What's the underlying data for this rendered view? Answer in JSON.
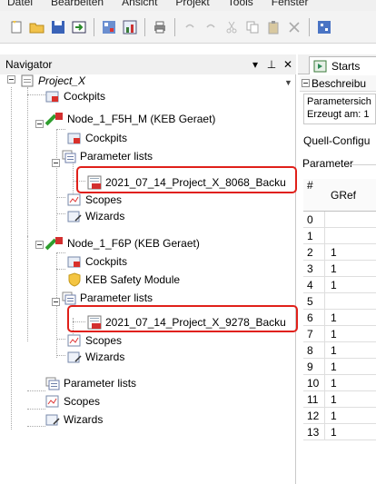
{
  "menubar": [
    "Datei",
    "Bearbeiten",
    "Ansicht",
    "Projekt",
    "Tools",
    "Fenster"
  ],
  "navigator": {
    "title": "Navigator",
    "buttons": {
      "dropdown": "▾",
      "pin": "⊥",
      "close": "✕"
    }
  },
  "tree": {
    "project": "Project_X",
    "project_cockpits": "Cockpits",
    "node1": "Node_1_F5H_M (KEB Geraet)",
    "node1_cockpits": "Cockpits",
    "node1_param_lists": "Parameter lists",
    "node1_backup": "2021_07_14_Project_X_8068_Backu",
    "node1_scopes": "Scopes",
    "node1_wizards": "Wizards",
    "node2": "Node_1_F6P (KEB Geraet)",
    "node2_cockpits": "Cockpits",
    "node2_safety": "KEB Safety Module",
    "node2_param_lists": "Parameter lists",
    "node2_backup": "2021_07_14_Project_X_9278_Backu",
    "node2_scopes": "Scopes",
    "node2_wizards": "Wizards",
    "root_param_lists": "Parameter lists",
    "root_scopes": "Scopes",
    "root_wizards": "Wizards"
  },
  "right_pane": {
    "tab_label": "Starts",
    "section_label": "Beschreibu",
    "desc_line1": "Parametersich",
    "desc_line2": "Erzeugt am: 1",
    "quell": "Quell-Configu",
    "param_group": "Parameter",
    "col_num": "#",
    "col_gref": "GRef",
    "rows": [
      {
        "num": "0",
        "gref": ""
      },
      {
        "num": "1",
        "gref": ""
      },
      {
        "num": "2",
        "gref": "1"
      },
      {
        "num": "3",
        "gref": "1"
      },
      {
        "num": "4",
        "gref": "1"
      },
      {
        "num": "5",
        "gref": ""
      },
      {
        "num": "6",
        "gref": "1"
      },
      {
        "num": "7",
        "gref": "1"
      },
      {
        "num": "8",
        "gref": "1"
      },
      {
        "num": "9",
        "gref": "1"
      },
      {
        "num": "10",
        "gref": "1"
      },
      {
        "num": "11",
        "gref": "1"
      },
      {
        "num": "12",
        "gref": "1"
      },
      {
        "num": "13",
        "gref": "1"
      }
    ]
  },
  "colors": {
    "highlight": "#e0201a",
    "node_green": "#2f9e2f",
    "keb_red": "#d32f2f",
    "folder_blue": "#4f7fc1"
  }
}
